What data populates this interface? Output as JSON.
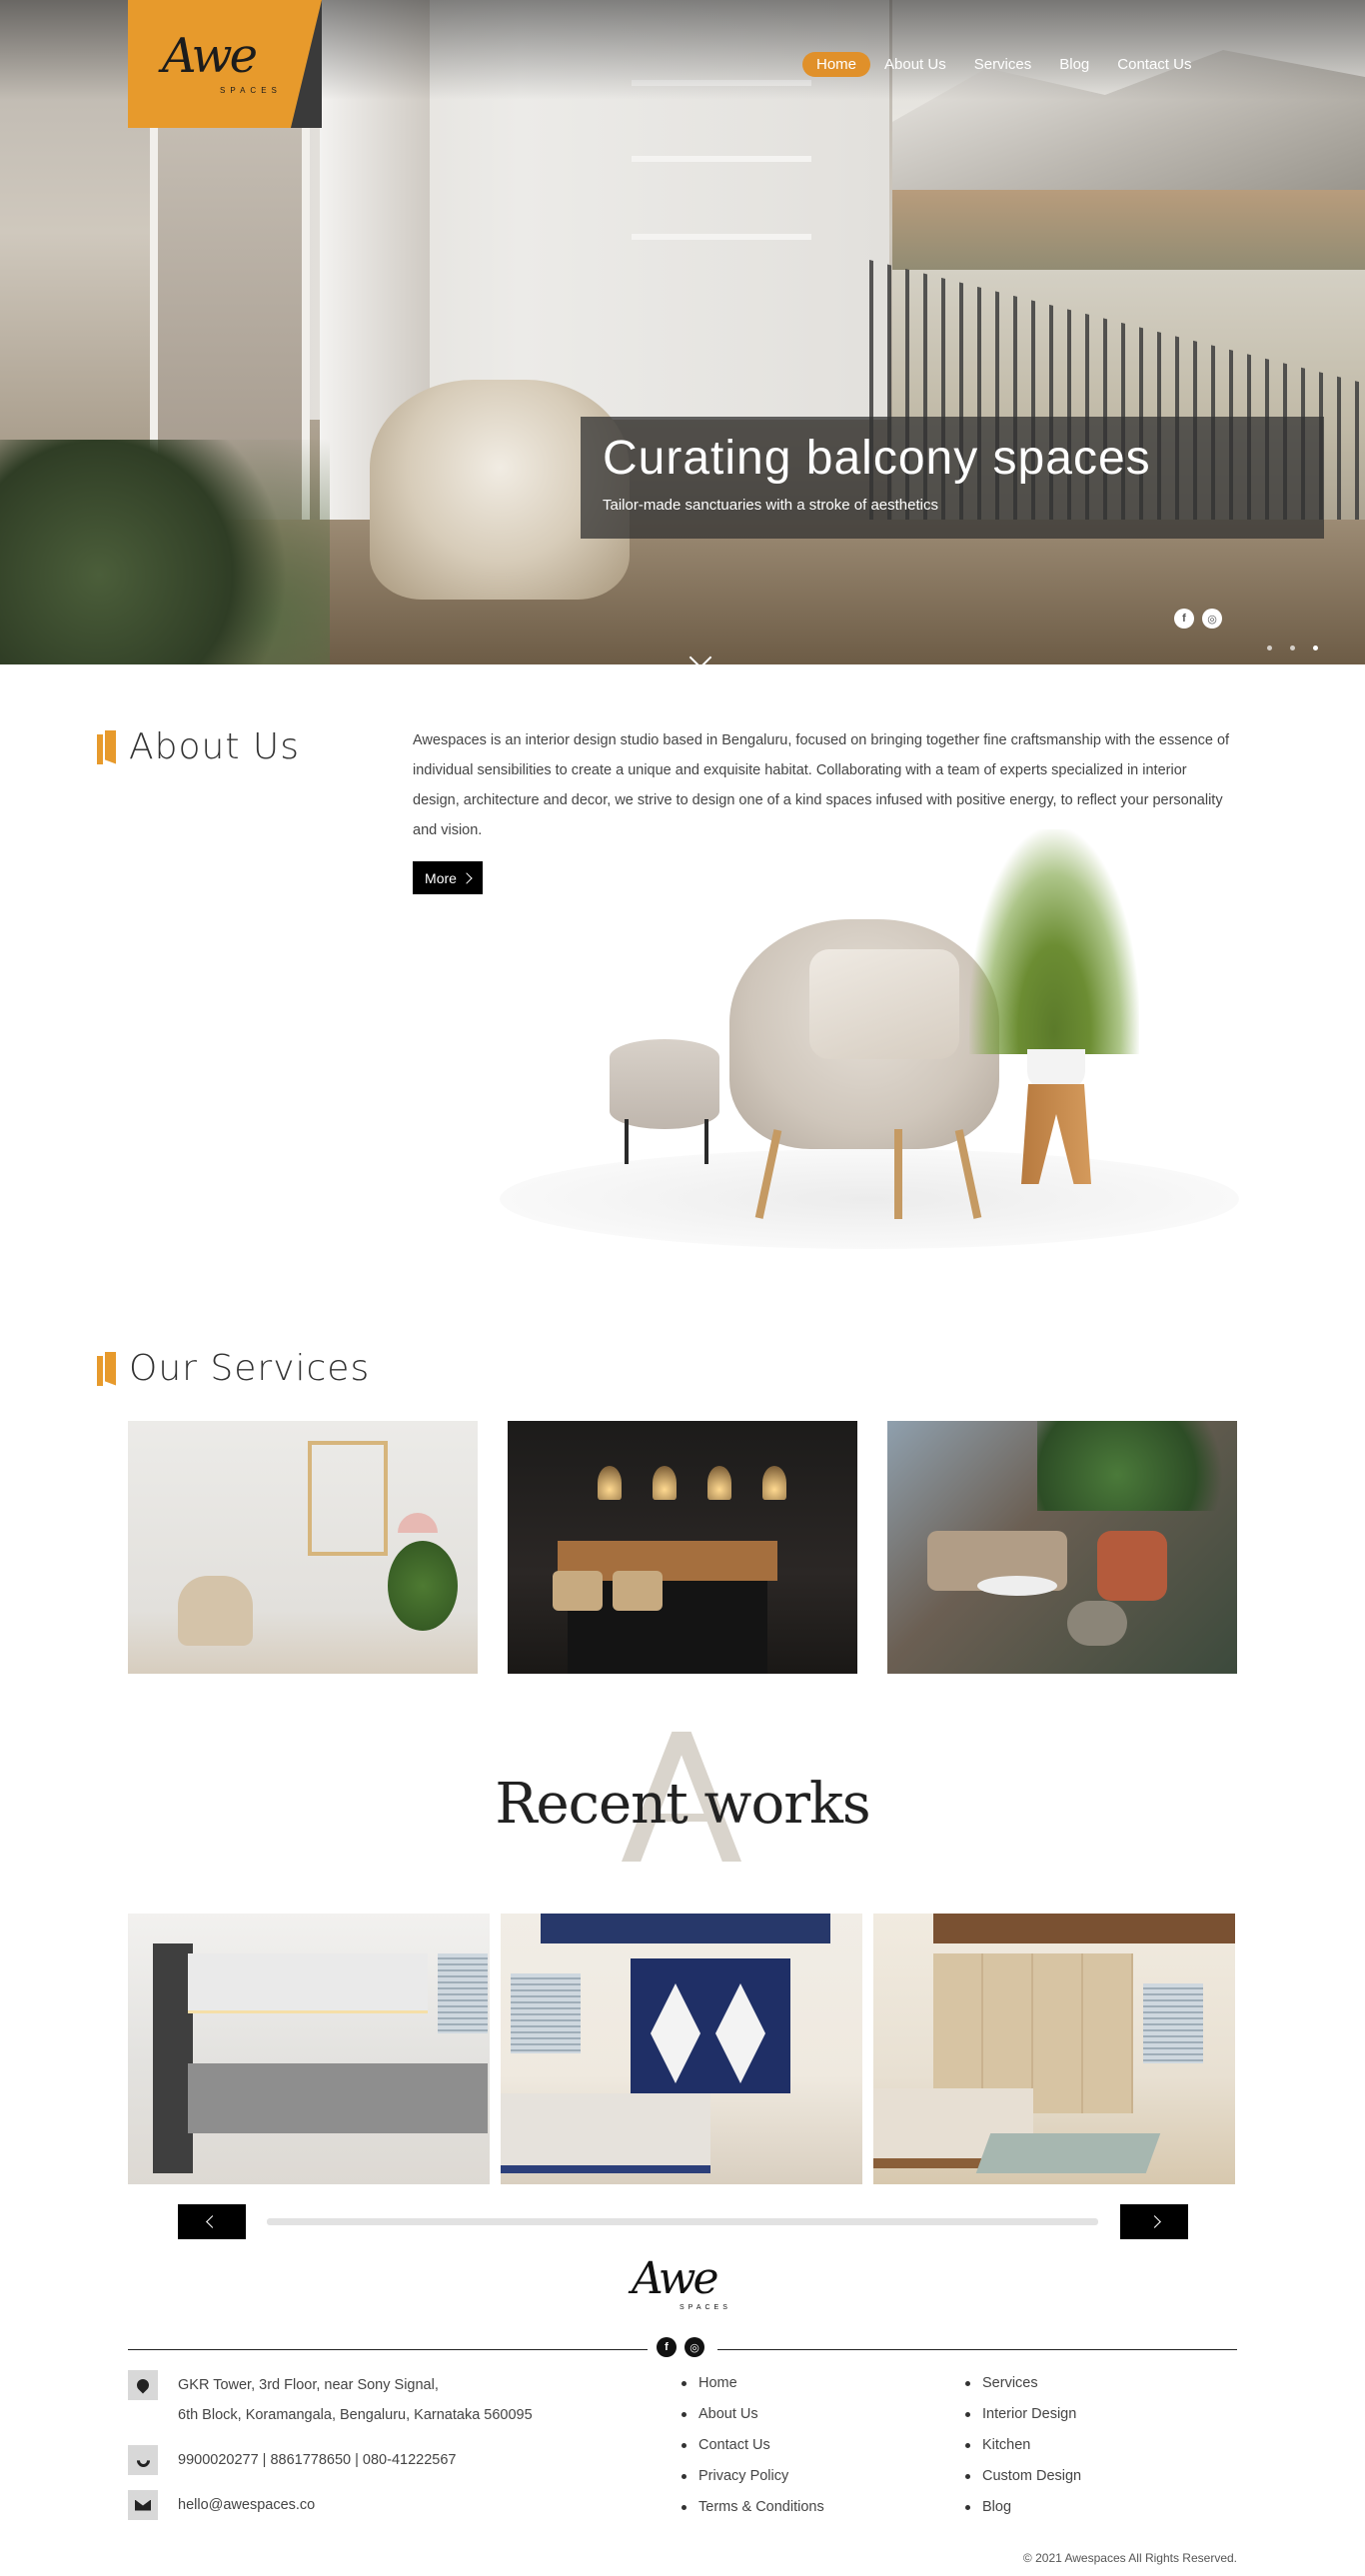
{
  "brand": {
    "logo_mark": "Awe",
    "logo_sub": "SPACES",
    "accent_color": "#e79a2c",
    "dark_color": "#000000"
  },
  "nav": {
    "items": [
      {
        "label": "Home",
        "active": true
      },
      {
        "label": "About Us",
        "active": false
      },
      {
        "label": "Services",
        "active": false
      },
      {
        "label": "Blog",
        "active": false
      },
      {
        "label": "Contact Us",
        "active": false
      }
    ]
  },
  "hero": {
    "title": "Curating balcony spaces",
    "subtitle": "Tailor-made sanctuaries with a stroke of aesthetics",
    "social": [
      "facebook-icon",
      "instagram-icon"
    ]
  },
  "about": {
    "heading": "About Us",
    "body": "Awespaces is an interior design studio based in Bengaluru, focused on bringing together fine craftsmanship with the essence of individual sensibilities to create a unique and exquisite habitat. Collaborating with a team of experts specialized in interior design, architecture and decor, we strive to design one of a kind spaces infused with positive energy, to reflect your personality and vision.",
    "more_label": "More"
  },
  "services": {
    "heading": "Our Services"
  },
  "recent_works": {
    "heading": "Recent works"
  },
  "footer": {
    "address_line1": "GKR Tower, 3rd Floor, near Sony Signal,",
    "address_line2": "6th Block, Koramangala, Bengaluru, Karnataka 560095",
    "phones": "9900020277 | 8861778650 | 080-41222567",
    "email": "hello@awespaces.co",
    "links_col1": [
      "Home",
      "About Us",
      "Contact Us",
      "Privacy Policy",
      "Terms & Conditions"
    ],
    "links_col2": [
      "Services",
      "Interior Design",
      "Kitchen",
      "Custom Design",
      "Blog"
    ],
    "copyright": "© 2021 Awespaces All Rights Reserved."
  }
}
